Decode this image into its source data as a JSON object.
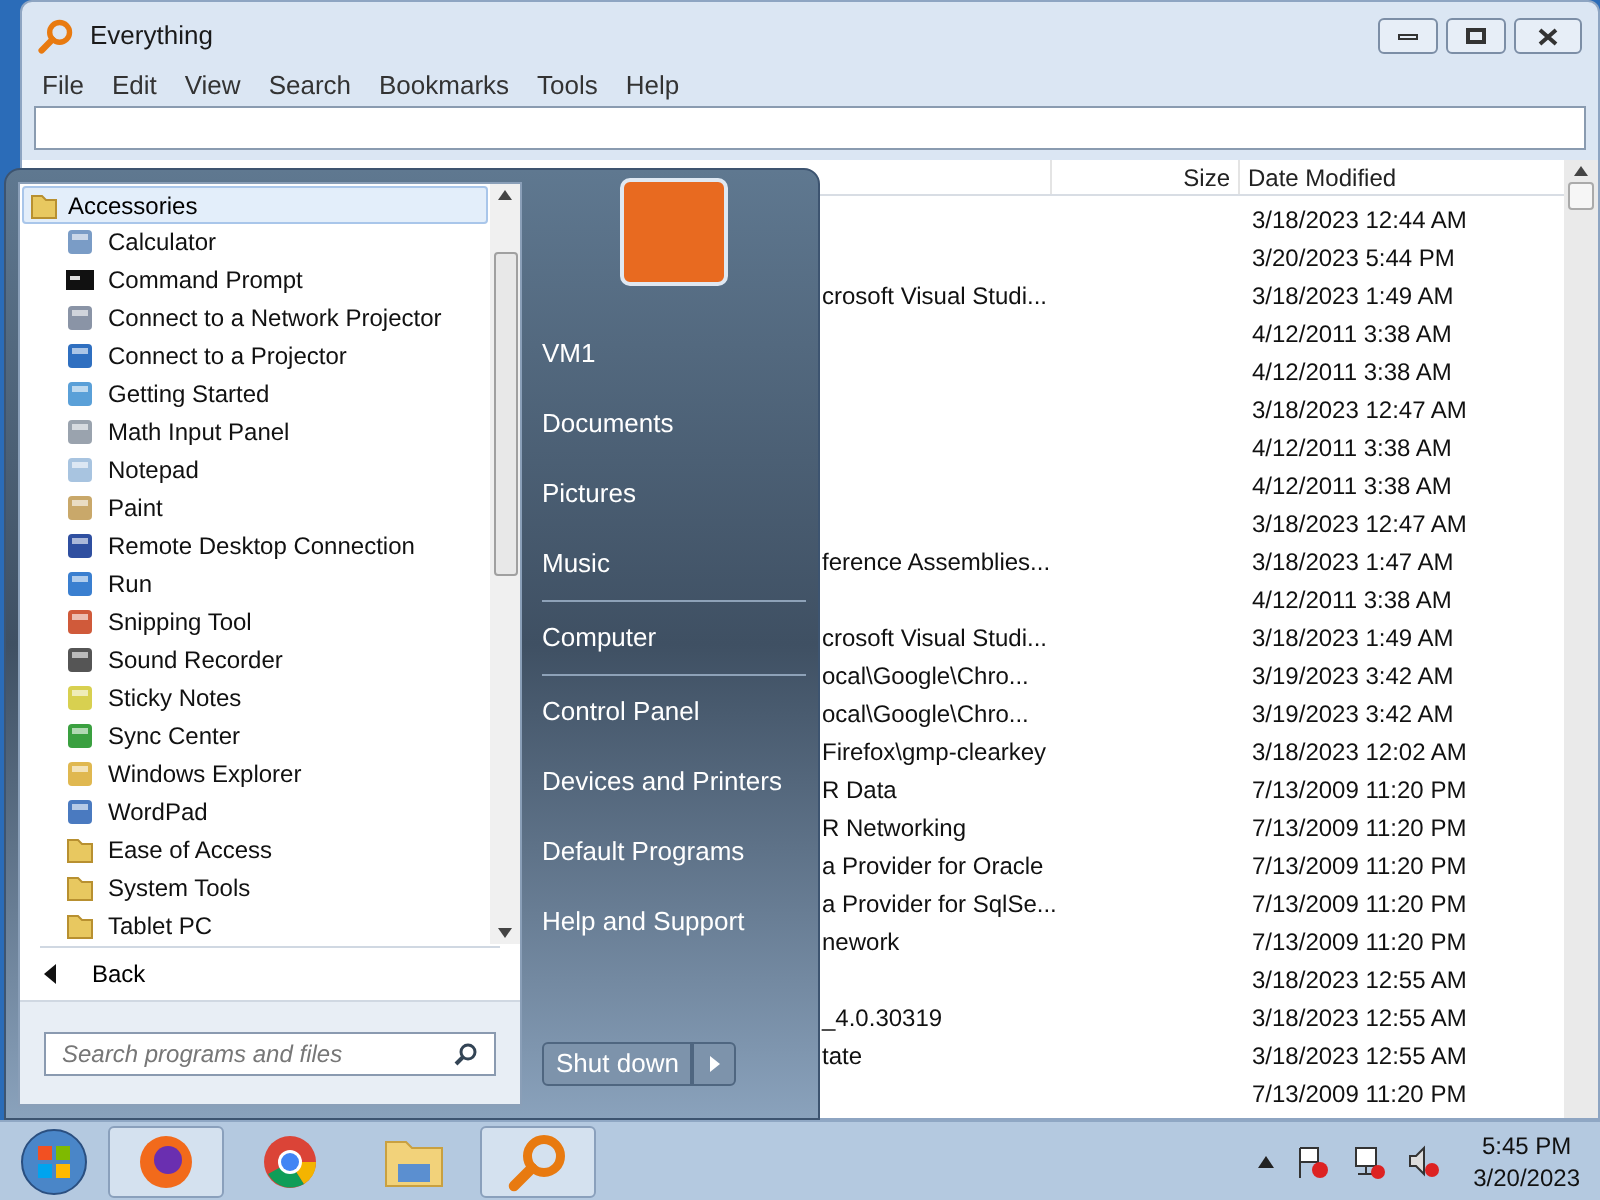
{
  "window": {
    "title": "Everything"
  },
  "menu": [
    "File",
    "Edit",
    "View",
    "Search",
    "Bookmarks",
    "Tools",
    "Help"
  ],
  "table": {
    "columns": [
      "Size",
      "Date Modified"
    ],
    "rows": [
      {
        "date": "3/18/2023 12:44 AM"
      },
      {
        "date": "3/20/2023 5:44 PM"
      },
      {
        "name": "crosoft Visual Studi...",
        "date": "3/18/2023 1:49 AM"
      },
      {
        "date": "4/12/2011 3:38 AM"
      },
      {
        "date": "4/12/2011 3:38 AM"
      },
      {
        "date": "3/18/2023 12:47 AM"
      },
      {
        "date": "4/12/2011 3:38 AM"
      },
      {
        "date": "4/12/2011 3:38 AM"
      },
      {
        "date": "3/18/2023 12:47 AM"
      },
      {
        "name": "ference Assemblies...",
        "date": "3/18/2023 1:47 AM"
      },
      {
        "date": "4/12/2011 3:38 AM"
      },
      {
        "name": "crosoft Visual Studi...",
        "date": "3/18/2023 1:49 AM"
      },
      {
        "name": "ocal\\Google\\Chro...",
        "date": "3/19/2023 3:42 AM"
      },
      {
        "name": "ocal\\Google\\Chro...",
        "date": "3/19/2023 3:42 AM"
      },
      {
        "name": "Firefox\\gmp-clearkey",
        "date": "3/18/2023 12:02 AM"
      },
      {
        "name": "R Data",
        "date": "7/13/2009 11:20 PM"
      },
      {
        "name": "R Networking",
        "date": "7/13/2009 11:20 PM"
      },
      {
        "name": "a Provider for Oracle",
        "date": "7/13/2009 11:20 PM"
      },
      {
        "name": "a Provider for SqlSe...",
        "date": "7/13/2009 11:20 PM"
      },
      {
        "name": "nework",
        "date": "7/13/2009 11:20 PM"
      },
      {
        "date": "3/18/2023 12:55 AM"
      },
      {
        "name": "_4.0.30319",
        "date": "3/18/2023 12:55 AM"
      },
      {
        "name": "tate",
        "date": "3/18/2023 12:55 AM"
      },
      {
        "date": "7/13/2009 11:20 PM"
      }
    ]
  },
  "start_menu": {
    "folder": {
      "label": "Accessories",
      "selected": true
    },
    "programs": [
      {
        "label": "Calculator",
        "kind": "app",
        "color": "#7a9cc6"
      },
      {
        "label": "Command Prompt",
        "kind": "console",
        "color": "#111111"
      },
      {
        "label": "Connect to a Network Projector",
        "kind": "app",
        "color": "#8a94a6"
      },
      {
        "label": "Connect to a Projector",
        "kind": "app",
        "color": "#2f6fc0"
      },
      {
        "label": "Getting Started",
        "kind": "app",
        "color": "#5aa0d8"
      },
      {
        "label": "Math Input Panel",
        "kind": "app",
        "color": "#9aa3ae"
      },
      {
        "label": "Notepad",
        "kind": "app",
        "color": "#a8c4e0"
      },
      {
        "label": "Paint",
        "kind": "app",
        "color": "#c9a86a"
      },
      {
        "label": "Remote Desktop Connection",
        "kind": "app",
        "color": "#2f4fa0"
      },
      {
        "label": "Run",
        "kind": "app",
        "color": "#3a7fd0"
      },
      {
        "label": "Snipping Tool",
        "kind": "app",
        "color": "#d05a3a"
      },
      {
        "label": "Sound Recorder",
        "kind": "app",
        "color": "#555555"
      },
      {
        "label": "Sticky Notes",
        "kind": "app",
        "color": "#d8d050"
      },
      {
        "label": "Sync Center",
        "kind": "app",
        "color": "#3aa040"
      },
      {
        "label": "Windows Explorer",
        "kind": "app",
        "color": "#e0b850"
      },
      {
        "label": "WordPad",
        "kind": "app",
        "color": "#4a7ac0"
      },
      {
        "label": "Ease of Access",
        "kind": "folder",
        "color": "#e8c860"
      },
      {
        "label": "System Tools",
        "kind": "folder",
        "color": "#e8c860"
      },
      {
        "label": "Tablet PC",
        "kind": "folder",
        "color": "#e8c860"
      }
    ],
    "back": "Back",
    "search": {
      "placeholder": "Search programs and files"
    },
    "places": [
      {
        "label": "VM1",
        "divider_after": false
      },
      {
        "label": "Documents",
        "divider_after": false
      },
      {
        "label": "Pictures",
        "divider_after": false
      },
      {
        "label": "Music",
        "divider_after": true
      },
      {
        "label": "Computer",
        "divider_after": true
      },
      {
        "label": "Control Panel",
        "divider_after": false
      },
      {
        "label": "Devices and Printers",
        "divider_after": false
      },
      {
        "label": "Default Programs",
        "divider_after": false
      },
      {
        "label": "Help and Support",
        "divider_after": false
      }
    ],
    "shutdown": "Shut down"
  },
  "taskbar": {
    "apps": [
      {
        "kind": "firefox",
        "active": true
      },
      {
        "kind": "chrome",
        "active": false
      },
      {
        "kind": "explorer",
        "active": false
      },
      {
        "kind": "search",
        "active": true
      }
    ],
    "time": "5:45 PM",
    "date": "3/20/2023"
  }
}
